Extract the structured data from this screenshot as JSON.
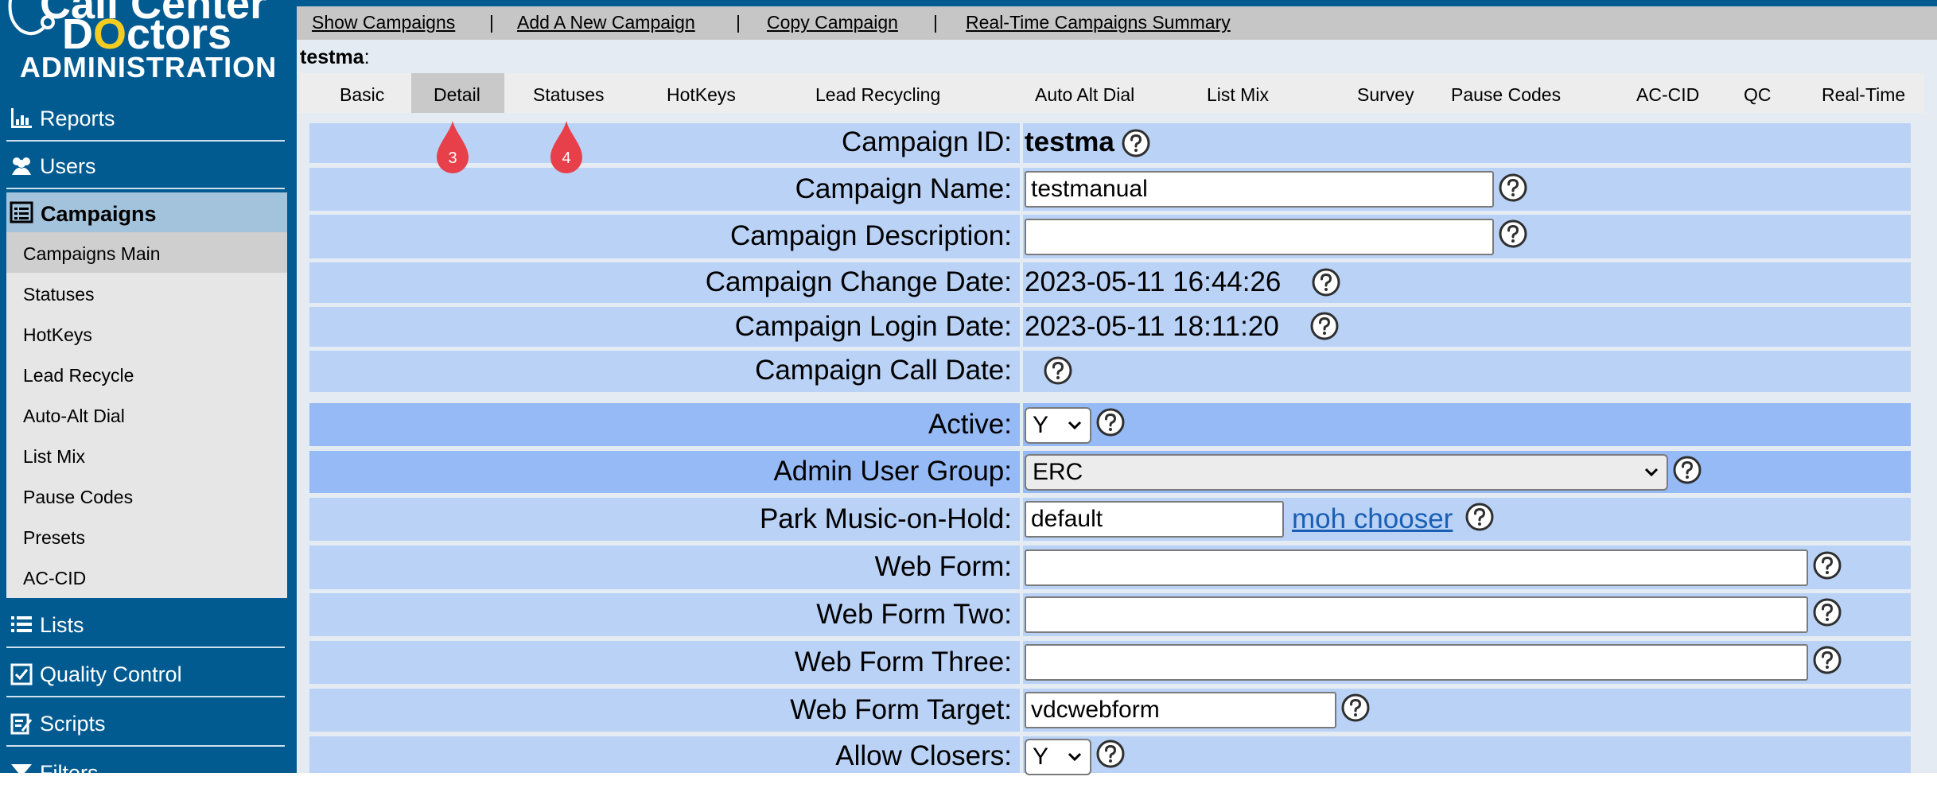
{
  "logo": {
    "line1": "Call Center",
    "line2_pre": "D",
    "line2_o": "O",
    "line2_post": "ctors",
    "admin": "ADMINISTRATION"
  },
  "sidebar": {
    "reports": "Reports",
    "users": "Users",
    "campaigns": "Campaigns",
    "submenu": [
      "Campaigns Main",
      "Statuses",
      "HotKeys",
      "Lead Recycle",
      "Auto-Alt Dial",
      "List Mix",
      "Pause Codes",
      "Presets",
      "AC-CID"
    ],
    "lists": "Lists",
    "quality": "Quality Control",
    "scripts": "Scripts",
    "filters": "Filters"
  },
  "topnav": {
    "show": "Show Campaigns",
    "add": "Add A New Campaign",
    "copy": "Copy Campaign",
    "summary": "Real-Time Campaigns Summary",
    "sep": "|"
  },
  "heading": {
    "name": "testma",
    "colon": ":"
  },
  "tabs": [
    "Basic",
    "Detail",
    "Statuses",
    "HotKeys",
    "Lead Recycling",
    "Auto Alt Dial",
    "List Mix",
    "Survey",
    "Pause Codes",
    "AC-CID",
    "QC",
    "Real-Time"
  ],
  "markers": [
    "3",
    "4"
  ],
  "form": {
    "campaign_id": {
      "label": "Campaign ID:",
      "value": "testma"
    },
    "campaign_name": {
      "label": "Campaign Name:",
      "value": "testmanual"
    },
    "campaign_description": {
      "label": "Campaign Description:",
      "value": ""
    },
    "change_date": {
      "label": "Campaign Change Date:",
      "value": "2023-05-11 16:44:26"
    },
    "login_date": {
      "label": "Campaign Login Date:",
      "value": "2023-05-11 18:11:20"
    },
    "call_date": {
      "label": "Campaign Call Date:",
      "value": ""
    },
    "active": {
      "label": "Active:",
      "value": "Y"
    },
    "admin_group": {
      "label": "Admin User Group:",
      "value": "ERC"
    },
    "park_moh": {
      "label": "Park Music-on-Hold:",
      "value": "default",
      "link": "moh chooser"
    },
    "web_form": {
      "label": "Web Form:",
      "value": ""
    },
    "web_form_two": {
      "label": "Web Form Two:",
      "value": ""
    },
    "web_form_three": {
      "label": "Web Form Three:",
      "value": ""
    },
    "web_form_target": {
      "label": "Web Form Target:",
      "value": "vdcwebform"
    },
    "allow_closers": {
      "label": "Allow Closers:",
      "value": "Y"
    }
  },
  "colors": {
    "sidebar": "#015b91",
    "row": "#b9d2f6",
    "row_dark": "#96baf5",
    "marker": "#e8404a"
  }
}
